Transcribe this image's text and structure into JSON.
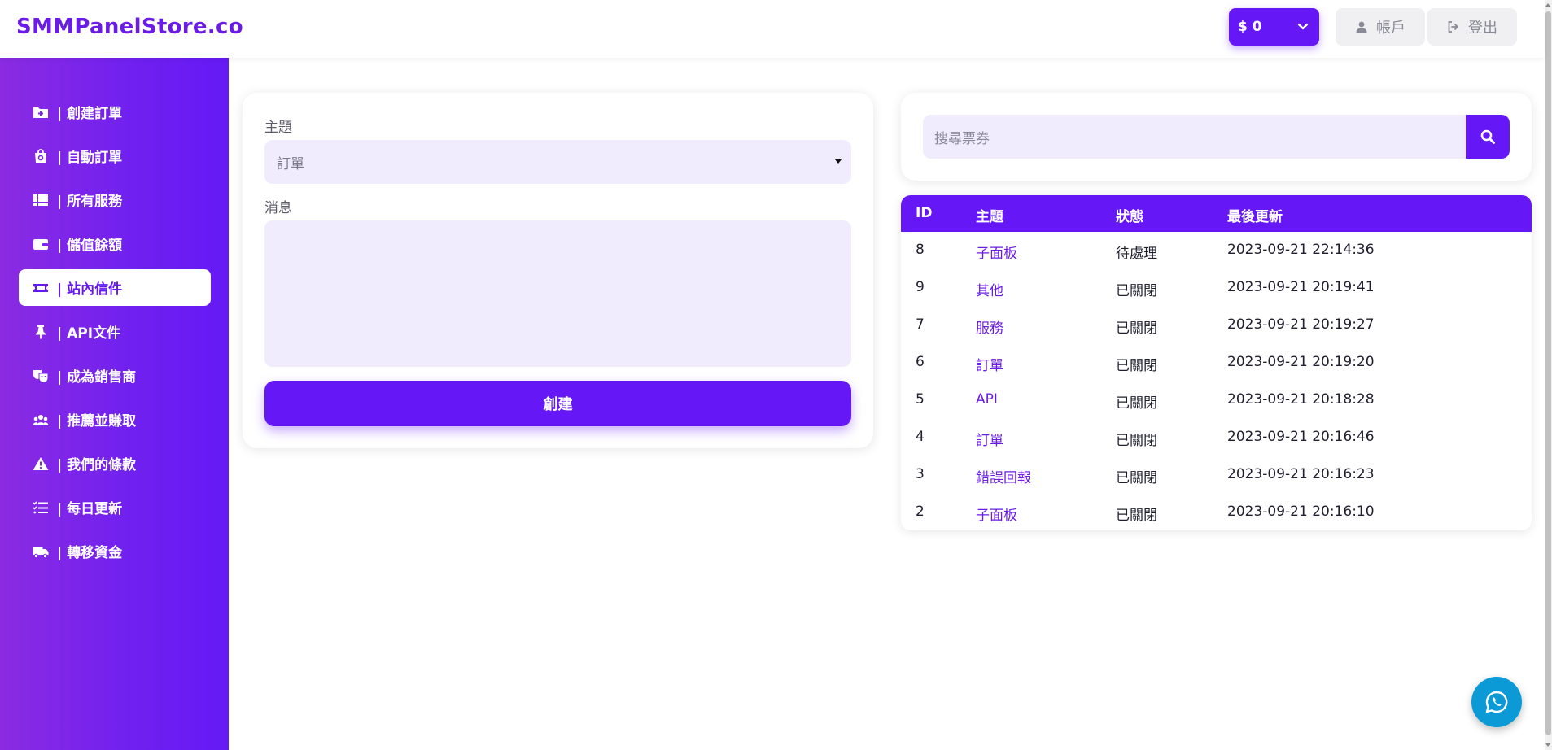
{
  "header": {
    "brand": "SMMPanelStore.co",
    "balance": "$ 0",
    "account_label": "帳戶",
    "logout_label": "登出"
  },
  "sidebar": {
    "items": [
      {
        "label": "| 創建訂單",
        "icon": "folder-plus-icon"
      },
      {
        "label": "| 自動訂單",
        "icon": "shopping-bag-icon"
      },
      {
        "label": "| 所有服務",
        "icon": "table-icon"
      },
      {
        "label": "| 儲值餘額",
        "icon": "wallet-icon"
      },
      {
        "label": "| 站內信件",
        "icon": "ticket-icon",
        "active": true
      },
      {
        "label": "| API文件",
        "icon": "pin-icon"
      },
      {
        "label": "| 成為銷售商",
        "icon": "masks-icon"
      },
      {
        "label": "| 推薦並賺取",
        "icon": "users-icon"
      },
      {
        "label": "| 我們的條款",
        "icon": "warning-icon"
      },
      {
        "label": "| 每日更新",
        "icon": "list-check-icon"
      },
      {
        "label": "| 轉移資金",
        "icon": "truck-icon"
      }
    ]
  },
  "ticket_form": {
    "subject_label": "主題",
    "subject_value": "訂單",
    "message_label": "消息",
    "message_value": "",
    "submit_label": "創建"
  },
  "search": {
    "placeholder": "搜尋票券"
  },
  "tickets": {
    "columns": [
      "ID",
      "主題",
      "狀態",
      "最後更新"
    ],
    "rows": [
      {
        "id": "8",
        "subject": "子面板",
        "status": "待處理",
        "updated": "2023-09-21 22:14:36"
      },
      {
        "id": "9",
        "subject": "其他",
        "status": "已關閉",
        "updated": "2023-09-21 20:19:41"
      },
      {
        "id": "7",
        "subject": "服務",
        "status": "已關閉",
        "updated": "2023-09-21 20:19:27"
      },
      {
        "id": "6",
        "subject": "訂單",
        "status": "已關閉",
        "updated": "2023-09-21 20:19:20"
      },
      {
        "id": "5",
        "subject": "API",
        "status": "已關閉",
        "updated": "2023-09-21 20:18:28"
      },
      {
        "id": "4",
        "subject": "訂單",
        "status": "已關閉",
        "updated": "2023-09-21 20:16:46"
      },
      {
        "id": "3",
        "subject": "錯誤回報",
        "status": "已關閉",
        "updated": "2023-09-21 20:16:23"
      },
      {
        "id": "2",
        "subject": "子面板",
        "status": "已關閉",
        "updated": "2023-09-21 20:16:10"
      }
    ]
  },
  "colors": {
    "brand": "#6a1be6",
    "accent": "#6518f5",
    "input_bg": "#f0ebfd",
    "whatsapp": "#0b9ad6"
  }
}
